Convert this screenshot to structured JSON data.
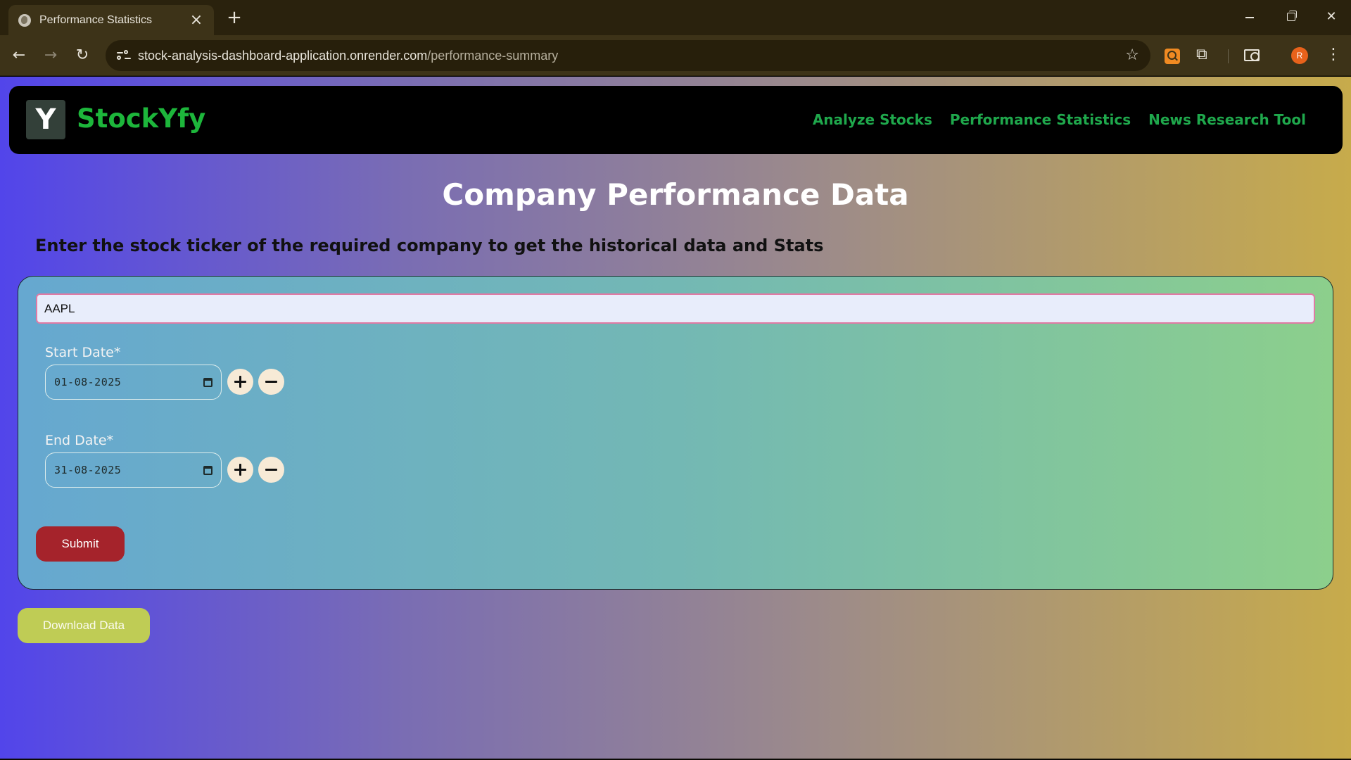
{
  "browser": {
    "tab_title": "Performance Statistics",
    "tab_close_glyph": "×",
    "new_tab_glyph": "+",
    "url_domain": "stock-analysis-dashboard-application.onrender.com",
    "url_path": "/performance-summary",
    "profile_initial": "R",
    "icons": [
      "globe-icon",
      "back-icon",
      "forward-icon",
      "reload-icon",
      "site-info-icon",
      "star-icon",
      "search-extension-icon",
      "puzzle-icon",
      "cast-icon",
      "kebab-icon"
    ],
    "glyphs": {
      "back": "←",
      "forward": "→",
      "reload": "↻",
      "star": "☆",
      "puzzle": "⧉",
      "kebab": "⋮",
      "close": "✕"
    }
  },
  "header": {
    "logo_letter": "Y",
    "brand": "StockYfy",
    "nav": [
      {
        "label": "Analyze Stocks"
      },
      {
        "label": "Performance Statistics"
      },
      {
        "label": "News Research Tool"
      }
    ]
  },
  "main": {
    "title": "Company Performance Data",
    "subtitle": "Enter the stock ticker of the required company to get the historical data and Stats",
    "ticker_value": "AAPL",
    "start_date": {
      "label": "Start Date*",
      "value": "01-08-2025"
    },
    "end_date": {
      "label": "End Date*",
      "value": "31-08-2025"
    },
    "submit_label": "Submit",
    "download_label": "Download Data"
  },
  "colors": {
    "brand_green": "#1db63b",
    "nav_green": "#1fa84c",
    "submit_red": "#a5232b",
    "download_lime": "#bfcc55",
    "gradient_start": "#5245ea",
    "gradient_end": "#c7ab4b"
  }
}
